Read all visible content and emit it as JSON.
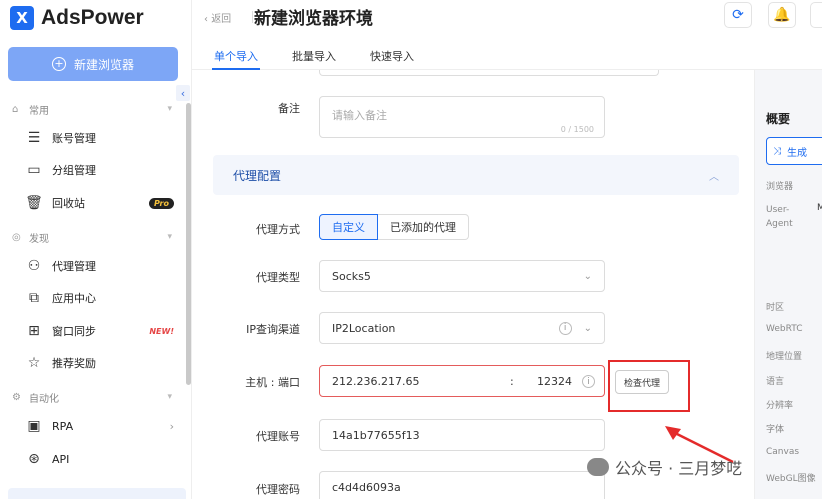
{
  "app": {
    "logo_letter": "X",
    "name": "AdsPower"
  },
  "sidebar": {
    "new_button": "新建浏览器",
    "sections": [
      {
        "title": "常用",
        "items": [
          {
            "label": "账号管理"
          },
          {
            "label": "分组管理"
          },
          {
            "label": "回收站",
            "badge": "Pro"
          }
        ]
      },
      {
        "title": "发现",
        "items": [
          {
            "label": "代理管理"
          },
          {
            "label": "应用中心"
          },
          {
            "label": "窗口同步",
            "badge": "NEW!"
          },
          {
            "label": "推荐奖励"
          }
        ]
      },
      {
        "title": "自动化",
        "items": [
          {
            "label": "RPA"
          },
          {
            "label": "API"
          }
        ]
      }
    ]
  },
  "header": {
    "back": "返回",
    "title": "新建浏览器环境"
  },
  "tabs": [
    {
      "label": "单个导入",
      "active": true
    },
    {
      "label": "批量导入"
    },
    {
      "label": "快速导入"
    }
  ],
  "form": {
    "remark": {
      "label": "备注",
      "placeholder": "请输入备注",
      "counter": "0 / 1500"
    },
    "proxy_section": "代理配置",
    "proxy_mode": {
      "label": "代理方式",
      "options": [
        "自定义",
        "已添加的代理"
      ],
      "selected": "自定义"
    },
    "proxy_type": {
      "label": "代理类型",
      "value": "Socks5"
    },
    "ip_channel": {
      "label": "IP查询渠道",
      "value": "IP2Location"
    },
    "host_port": {
      "label": "主机 : 端口",
      "host": "212.236.217.65",
      "colon": ":",
      "port": "12324"
    },
    "check_button": "检查代理",
    "proxy_account": {
      "label": "代理账号",
      "value": "14a1b77655f13"
    },
    "proxy_password": {
      "label": "代理密码",
      "value": "c4d4d6093a"
    }
  },
  "overview": {
    "title": "概要",
    "generate": "生成",
    "labels": [
      "浏览器",
      "User-Agent",
      "时区",
      "WebRTC",
      "地理位置",
      "语言",
      "分辨率",
      "字体",
      "Canvas",
      "WebGL图像"
    ],
    "ua_value": "M"
  },
  "watermark": "公众号 · 三月梦呓",
  "colors": {
    "accent": "#1e6cf0",
    "highlight": "#e42b2b"
  }
}
